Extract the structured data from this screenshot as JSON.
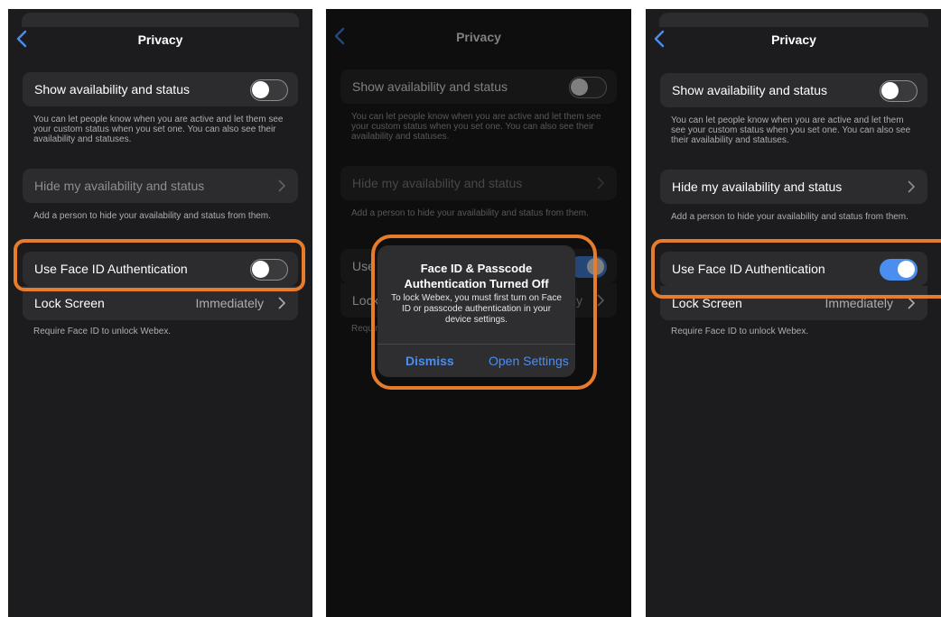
{
  "nav": {
    "title": "Privacy"
  },
  "settings": {
    "show_status_label": "Show availability and status",
    "show_status_footnote": "You can let people know when you are active and let them see your custom status when you set one. You can also see their availability and statuses.",
    "hide_status_label": "Hide my availability and status",
    "hide_status_footnote": "Add a person to hide your availability and status from them.",
    "face_id_label": "Use Face ID Authentication",
    "lock_screen_label": "Lock Screen",
    "lock_screen_value": "Immediately",
    "lock_screen_footnote": "Require Face ID to unlock Webex."
  },
  "panels": [
    {
      "face_id_enabled": false,
      "show_status_enabled": false
    },
    {
      "face_id_enabled": true,
      "show_status_enabled": false
    },
    {
      "face_id_enabled": true,
      "show_status_enabled": false
    }
  ],
  "dialog": {
    "title": "Face ID & Passcode Authentication Turned Off",
    "message": "To lock Webex, you must first turn on Face ID or passcode authentication in your device settings.",
    "dismiss_label": "Dismiss",
    "open_settings_label": "Open Settings"
  },
  "colors": {
    "accent_blue": "#4b8ef0",
    "highlight_orange": "#e67c2c",
    "background": "#1c1c1e",
    "card": "#2c2c2e"
  },
  "icons": {
    "back": "chevron-left-icon",
    "disclosure": "chevron-right-icon"
  }
}
